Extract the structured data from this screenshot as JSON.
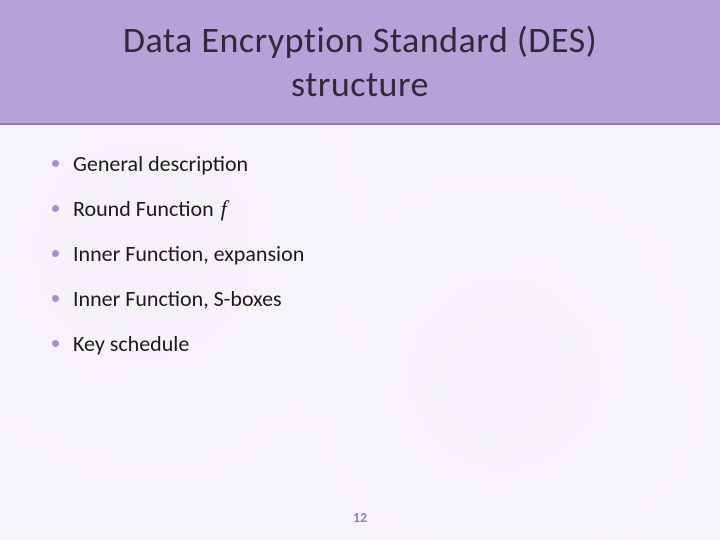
{
  "header": {
    "title_line1": "Data Encryption Standard (DES)",
    "title_line2": "structure"
  },
  "bullets": {
    "items": [
      {
        "label": "General description"
      },
      {
        "label": "Round Function ",
        "math": "f"
      },
      {
        "label": "Inner Function, expansion"
      },
      {
        "label": "Inner Function, S-boxes"
      },
      {
        "label": "Key schedule"
      }
    ]
  },
  "footer": {
    "page_number": "12"
  }
}
